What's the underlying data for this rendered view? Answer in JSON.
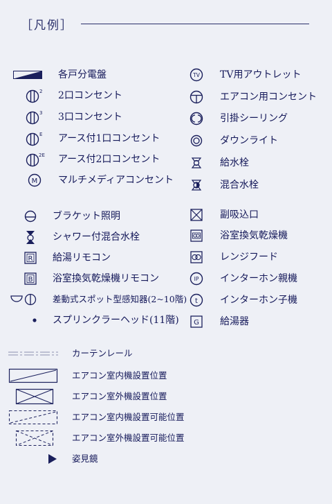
{
  "legend": {
    "title": "［凡例］",
    "left_items": [
      {
        "icon": "distribution-board-icon",
        "label": "各戸分電盤"
      },
      {
        "icon": "outlet-2-icon",
        "label": "2口コンセント",
        "sup": "2"
      },
      {
        "icon": "outlet-3-icon",
        "label": "3口コンセント",
        "sup": "3"
      },
      {
        "icon": "outlet-earth-1-icon",
        "label": "アース付1口コンセント",
        "sup": "E"
      },
      {
        "icon": "outlet-earth-2-icon",
        "label": "アース付2口コンセント",
        "sup": "2E"
      },
      {
        "icon": "multimedia-outlet-icon",
        "label": "マルチメディアコンセント",
        "letter": "M"
      },
      {
        "icon": "bracket-light-icon",
        "label": "ブラケット照明"
      },
      {
        "icon": "shower-faucet-icon",
        "label": "シャワー付混合水栓"
      },
      {
        "icon": "water-heater-remote-icon",
        "label": "給湯リモコン",
        "letter": "R"
      },
      {
        "icon": "bath-dryer-remote-icon",
        "label": "浴室換気乾燥機リモコン",
        "letter": "B"
      },
      {
        "icon": "heat-detector-icon",
        "label": "差動式スポット型感知器(2~10階)"
      },
      {
        "icon": "sprinkler-icon",
        "label": "スプリンクラーヘッド(11階)"
      }
    ],
    "right_items": [
      {
        "icon": "tv-outlet-icon",
        "label": "TV用アウトレット",
        "letter": "TV"
      },
      {
        "icon": "aircon-outlet-icon",
        "label": "エアコン用コンセント"
      },
      {
        "icon": "ceiling-light-icon",
        "label": "引掛シーリング"
      },
      {
        "icon": "downlight-icon",
        "label": "ダウンライト"
      },
      {
        "icon": "water-faucet-icon",
        "label": "給水栓"
      },
      {
        "icon": "mixing-faucet-icon",
        "label": "混合水栓"
      },
      {
        "icon": "sub-intake-icon",
        "label": "副吸込口"
      },
      {
        "icon": "bath-dryer-icon",
        "label": "浴室換気乾燥機"
      },
      {
        "icon": "range-hood-icon",
        "label": "レンジフード"
      },
      {
        "icon": "intercom-main-icon",
        "label": "インターホン親機",
        "letter": "IP"
      },
      {
        "icon": "intercom-sub-icon",
        "label": "インターホン子機",
        "letter": "t"
      },
      {
        "icon": "water-heater-icon",
        "label": "給湯器",
        "letter": "G"
      }
    ],
    "bottom_items": [
      {
        "icon": "curtain-rail-icon",
        "label": "カーテンレール"
      },
      {
        "icon": "aircon-indoor-icon",
        "label": "エアコン室内機設置位置"
      },
      {
        "icon": "aircon-outdoor-icon",
        "label": "エアコン室外機設置位置"
      },
      {
        "icon": "aircon-indoor-possible-icon",
        "label": "エアコン室内機設置可能位置"
      },
      {
        "icon": "aircon-outdoor-possible-icon",
        "label": "エアコン室外機設置可能位置"
      },
      {
        "icon": "mirror-icon",
        "label": "姿見鏡"
      }
    ],
    "colors": {
      "ink": "#1a1f5c",
      "background": "#eef0f6"
    }
  }
}
